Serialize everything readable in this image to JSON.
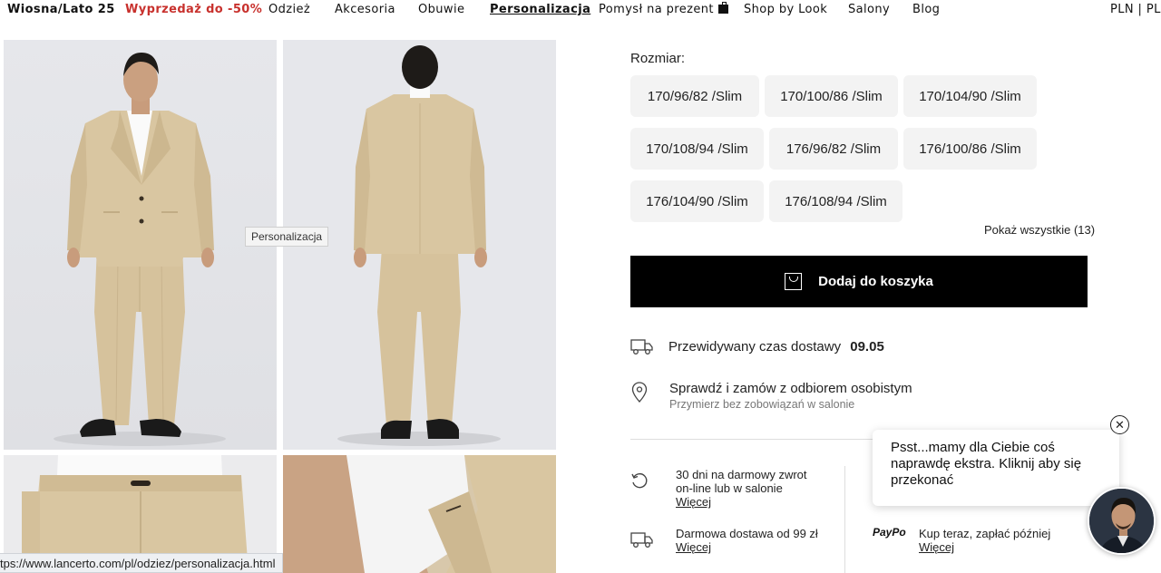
{
  "nav": {
    "items": [
      {
        "label": "Wiosna/Lato 25"
      },
      {
        "label": "Wyprzedaż do -50%"
      },
      {
        "label": "Odzież"
      },
      {
        "label": "Akcesoria"
      },
      {
        "label": "Obuwie"
      },
      {
        "label": "Personalizacja"
      },
      {
        "label": "Pomysł na prezent"
      },
      {
        "label": "Shop by Look"
      },
      {
        "label": "Salony"
      },
      {
        "label": "Blog"
      }
    ],
    "locale": "PLN | PL",
    "sale_color": "#c8312d"
  },
  "gallery": {
    "tooltip": "Personalizacja",
    "suit_color": "#d9c6a1"
  },
  "status_url": "tps://www.lancerto.com/pl/odziez/personalizacja.html",
  "product": {
    "size_label": "Rozmiar:",
    "sizes": [
      "170/96/82 /Slim",
      "170/100/86 /Slim",
      "170/104/90 /Slim",
      "170/108/94 /Slim",
      "176/96/82 /Slim",
      "176/100/86 /Slim",
      "176/104/90 /Slim",
      "176/108/94 /Slim"
    ],
    "show_all": "Pokaż wszystkie (13)",
    "add_to_cart": "Dodaj do koszyka",
    "delivery_label": "Przewidywany czas dostawy",
    "delivery_date": "09.05",
    "pickup_title": "Sprawdź i zamów z odbiorem osobistym",
    "pickup_sub": "Przymierz bez zobowiązań w salonie"
  },
  "benefits": {
    "returns_line1": "30 dni na darmowy zwrot",
    "returns_line2": "on-line lub w salonie",
    "returns_more": "Więcej",
    "shipping": "Darmowa dostawa od 99 zł",
    "shipping_more": "Więcej",
    "paypo_logo": "PayPo",
    "paypo_text": "Kup teraz, zapłać później",
    "paypo_more": "Więcej"
  },
  "chat": {
    "message": "Psst...mamy dla Ciebie coś naprawdę ekstra. Kliknij aby się przekonać",
    "close": "✕"
  }
}
